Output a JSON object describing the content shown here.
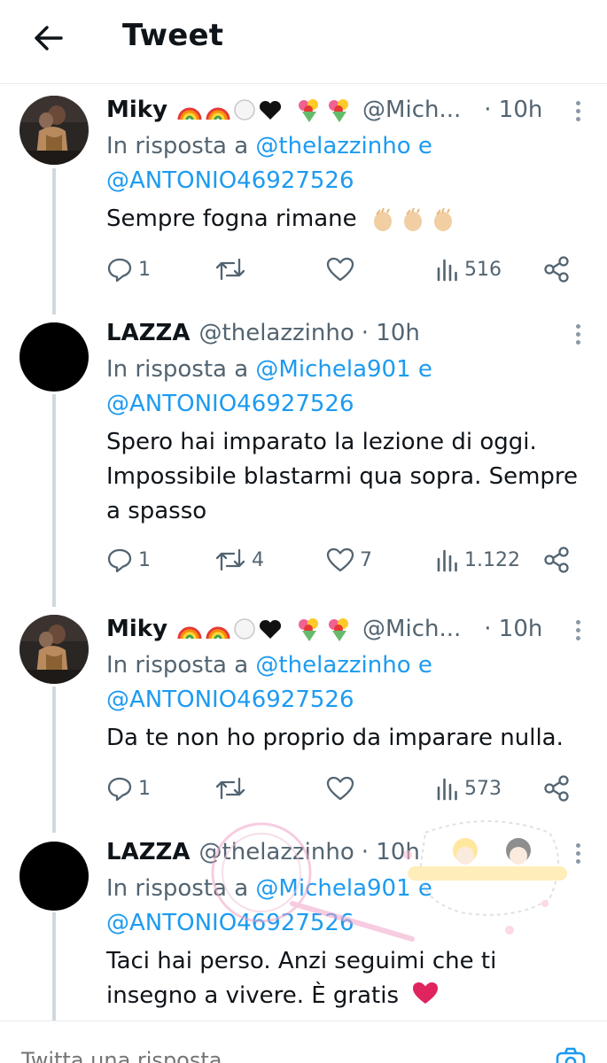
{
  "header": {
    "title": "Tweet"
  },
  "tweets": [
    {
      "name": "Miky",
      "handle": "@Mich...",
      "time": "· 10h",
      "reply_prefix": "In risposta a",
      "reply_user1": "@thelazzinho",
      "reply_conj": "e",
      "reply_user2": "@ANTONIO46927526",
      "text": "Sempre fogna rimane",
      "replies": "1",
      "retweets": "",
      "likes": "",
      "views": "516"
    },
    {
      "name": "LAZZA",
      "handle": "@thelazzinho",
      "time": "· 10h",
      "reply_prefix": "In risposta a",
      "reply_user1": "@Michela901",
      "reply_conj": "e",
      "reply_user2": "@ANTONIO46927526",
      "text_lines": [
        "Spero hai imparato la lezione di oggi.",
        "Impossibile blastarmi qua sopra. Sempre",
        "a spasso"
      ],
      "replies": "1",
      "retweets": "4",
      "likes": "7",
      "views": "1.122"
    },
    {
      "name": "Miky",
      "handle": "@Mich...",
      "time": "· 10h",
      "reply_prefix": "In risposta a",
      "reply_user1": "@thelazzinho",
      "reply_conj": "e",
      "reply_user2": "@ANTONIO46927526",
      "text": "Da te non ho proprio da imparare nulla.",
      "replies": "1",
      "retweets": "",
      "likes": "",
      "views": "573"
    },
    {
      "name": "LAZZA",
      "handle": "@thelazzinho",
      "time": "· 10h",
      "reply_prefix": "In risposta a",
      "reply_user1": "@Michela901",
      "reply_conj": "e",
      "reply_user2": "@ANTONIO46927526",
      "text_lines": [
        "Taci hai perso. Anzi seguimi che ti",
        "insegno a vivere. È gratis"
      ]
    }
  ],
  "composer": {
    "placeholder": "Twitta una risposta"
  },
  "colors": {
    "link": "#1d9bf0",
    "muted": "#536471",
    "text": "#0f1419",
    "thread": "#cfd9de"
  },
  "icons": [
    "back-arrow-icon",
    "reply-icon",
    "retweet-icon",
    "like-icon",
    "views-icon",
    "share-icon",
    "more-icon",
    "camera-icon",
    "rainbow-emoji",
    "bouquet-emoji",
    "clap-emoji",
    "heart-emoji"
  ]
}
